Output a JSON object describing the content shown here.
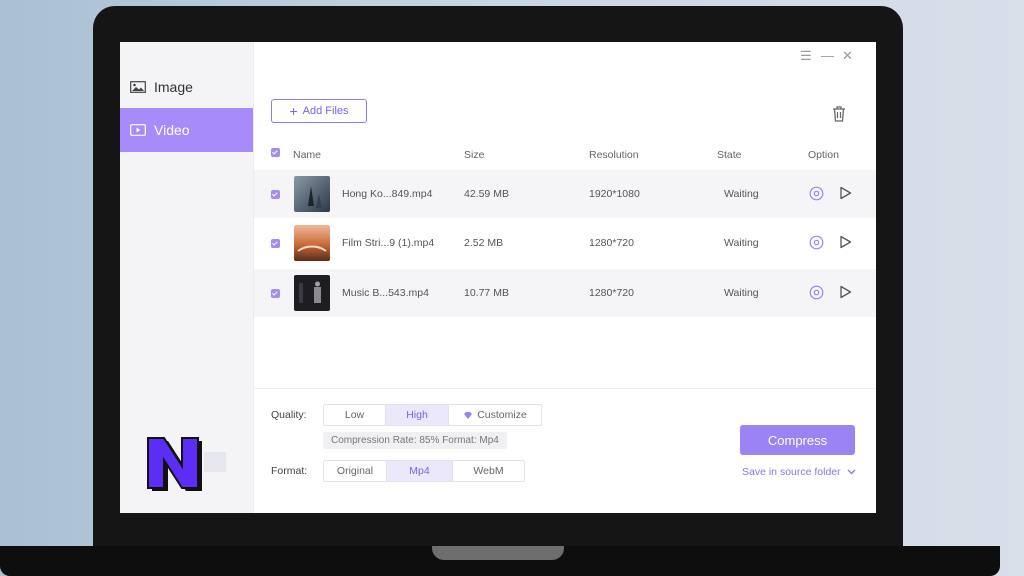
{
  "window": {
    "menu_icon": "menu-icon",
    "minimize_icon": "minimize-icon",
    "close_icon": "close-icon"
  },
  "sidebar": {
    "items": [
      {
        "label": "Image",
        "icon": "image-icon"
      },
      {
        "label": "Video",
        "icon": "video-icon",
        "active": true
      }
    ],
    "logo_letter": "N"
  },
  "toolbar": {
    "add_files_label": "Add Files",
    "trash_icon": "trash-icon"
  },
  "table": {
    "headers": {
      "name": "Name",
      "size": "Size",
      "resolution": "Resolution",
      "state": "State",
      "option": "Option"
    },
    "rows": [
      {
        "name": "Hong Ko...849.mp4",
        "size": "42.59 MB",
        "resolution": "1920*1080",
        "state": "Waiting"
      },
      {
        "name": "Film Stri...9 (1).mp4",
        "size": "2.52 MB",
        "resolution": "1280*720",
        "state": "Waiting"
      },
      {
        "name": "Music B...543.mp4",
        "size": "10.77 MB",
        "resolution": "1280*720",
        "state": "Waiting"
      }
    ]
  },
  "settings": {
    "quality_label": "Quality:",
    "quality_options": [
      "Low",
      "High",
      "Customize"
    ],
    "quality_selected": "High",
    "info": "Compression Rate: 85% Format: Mp4",
    "format_label": "Format:",
    "format_options": [
      "Original",
      "Mp4",
      "WebM"
    ],
    "format_selected": "Mp4"
  },
  "actions": {
    "compress_label": "Compress",
    "save_location": "Save in source folder"
  },
  "colors": {
    "accent": "#9b83f4",
    "sidebar_active": "#a78bfa",
    "logo_fill": "#5b2df5"
  }
}
